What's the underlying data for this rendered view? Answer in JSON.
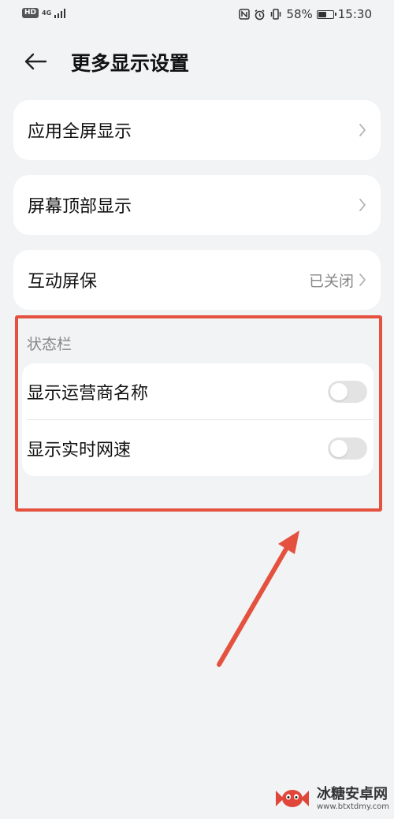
{
  "status_bar": {
    "hd": "HD",
    "network": "4G",
    "battery_pct": "58%",
    "battery_level": 0.58,
    "time": "15:30"
  },
  "header": {
    "title": "更多显示设置"
  },
  "settings": [
    {
      "label": "应用全屏显示",
      "value": ""
    },
    {
      "label": "屏幕顶部显示",
      "value": ""
    },
    {
      "label": "互动屏保",
      "value": "已关闭"
    }
  ],
  "status_section": {
    "title": "状态栏",
    "rows": [
      {
        "label": "显示运营商名称",
        "on": false
      },
      {
        "label": "显示实时网速",
        "on": false
      }
    ]
  },
  "watermark": {
    "name": "冰糖安卓网",
    "url": "www.btxtdmy.com"
  },
  "colors": {
    "background": "#f1f3f5",
    "card": "#ffffff",
    "highlight": "#e5513f",
    "secondary_text": "#888888"
  }
}
